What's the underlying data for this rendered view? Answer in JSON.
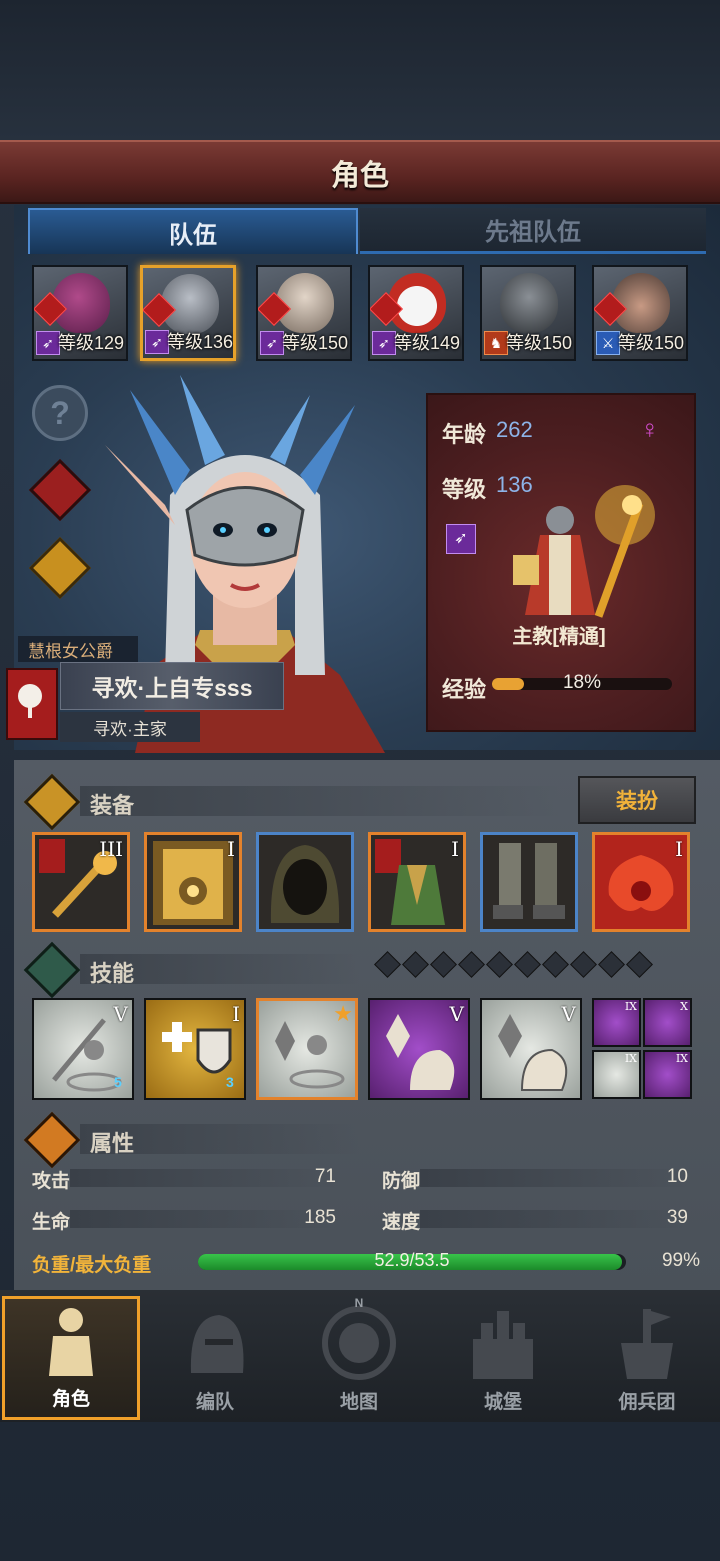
{
  "header": {
    "title": "角色"
  },
  "tabs": [
    {
      "label": "队伍",
      "active": true
    },
    {
      "label": "先祖队伍",
      "active": false
    }
  ],
  "team": [
    {
      "level_text": "等级129",
      "class_icon": "spear-icon",
      "selected": false
    },
    {
      "level_text": "等级136",
      "class_icon": "spear-icon",
      "selected": true
    },
    {
      "level_text": "等级150",
      "class_icon": "spear-icon",
      "selected": false
    },
    {
      "level_text": "等级149",
      "class_icon": "spear-icon",
      "selected": false
    },
    {
      "level_text": "等级150",
      "class_icon": "horse-icon",
      "selected": false
    },
    {
      "level_text": "等级150",
      "class_icon": "sword-icon",
      "selected": false
    }
  ],
  "side_icons": [
    "help-icon",
    "red-figure-icon",
    "potion-icon"
  ],
  "noble": {
    "title": "慧根女公爵",
    "name": "寻欢·上自专sss",
    "house": "寻欢·主家"
  },
  "info": {
    "age_label": "年龄",
    "age_value": "262",
    "level_label": "等级",
    "level_value": "136",
    "class_name": "主教[精通]",
    "xp_label": "经验",
    "xp_text": "18%",
    "xp_fraction": 0.18,
    "gender_icon": "female-icon"
  },
  "equipment": {
    "label": "装备",
    "dress_button": "装扮",
    "items": [
      {
        "tier": "III",
        "rarity": "orange",
        "icon": "staff-icon"
      },
      {
        "tier": "I",
        "rarity": "orange",
        "icon": "book-icon"
      },
      {
        "tier": "",
        "rarity": "blue",
        "icon": "hood-icon"
      },
      {
        "tier": "I",
        "rarity": "orange",
        "icon": "armor-icon"
      },
      {
        "tier": "",
        "rarity": "blue",
        "icon": "boots-icon"
      },
      {
        "tier": "I",
        "rarity": "red",
        "icon": "amulet-icon"
      }
    ]
  },
  "skills": {
    "label": "技能",
    "pip_count": 10,
    "items": [
      {
        "tier": "V",
        "badge": "5",
        "style": "white",
        "icon": "spear-summon-icon"
      },
      {
        "tier": "I",
        "badge": "3",
        "style": "gold",
        "icon": "holy-shield-icon"
      },
      {
        "tier": "",
        "badge": "",
        "style": "white",
        "icon": "crystal-summon-icon",
        "starred": true
      },
      {
        "tier": "V",
        "badge": "",
        "style": "purple",
        "icon": "crystal-hand-icon"
      },
      {
        "tier": "V",
        "badge": "",
        "style": "white",
        "icon": "crystal-hand-icon"
      }
    ],
    "mini": [
      {
        "tier": "IX",
        "style": "purple",
        "icon": "staff-strike-icon"
      },
      {
        "tier": "X",
        "style": "purple",
        "icon": "holy-burst-icon"
      },
      {
        "tier": "IX",
        "style": "white",
        "icon": "shatter-icon"
      },
      {
        "tier": "IX",
        "style": "purple",
        "icon": "explosion-icon"
      }
    ]
  },
  "attributes": {
    "label": "属性",
    "attack_label": "攻击",
    "attack": "71",
    "defense_label": "防御",
    "defense": "10",
    "hp_label": "生命",
    "hp": "185",
    "speed_label": "速度",
    "speed": "39",
    "load_label": "负重/最大负重",
    "load_text": "52.9/53.5",
    "load_percent": "99%",
    "load_fraction": 0.99
  },
  "nav": [
    {
      "label": "角色",
      "icon": "knight-icon",
      "active": true
    },
    {
      "label": "编队",
      "icon": "helmet-icon",
      "active": false
    },
    {
      "label": "地图",
      "icon": "compass-icon",
      "active": false,
      "compass_letter": "N"
    },
    {
      "label": "城堡",
      "icon": "castle-icon",
      "active": false
    },
    {
      "label": "佣兵团",
      "icon": "mercenary-icon",
      "active": false
    }
  ]
}
